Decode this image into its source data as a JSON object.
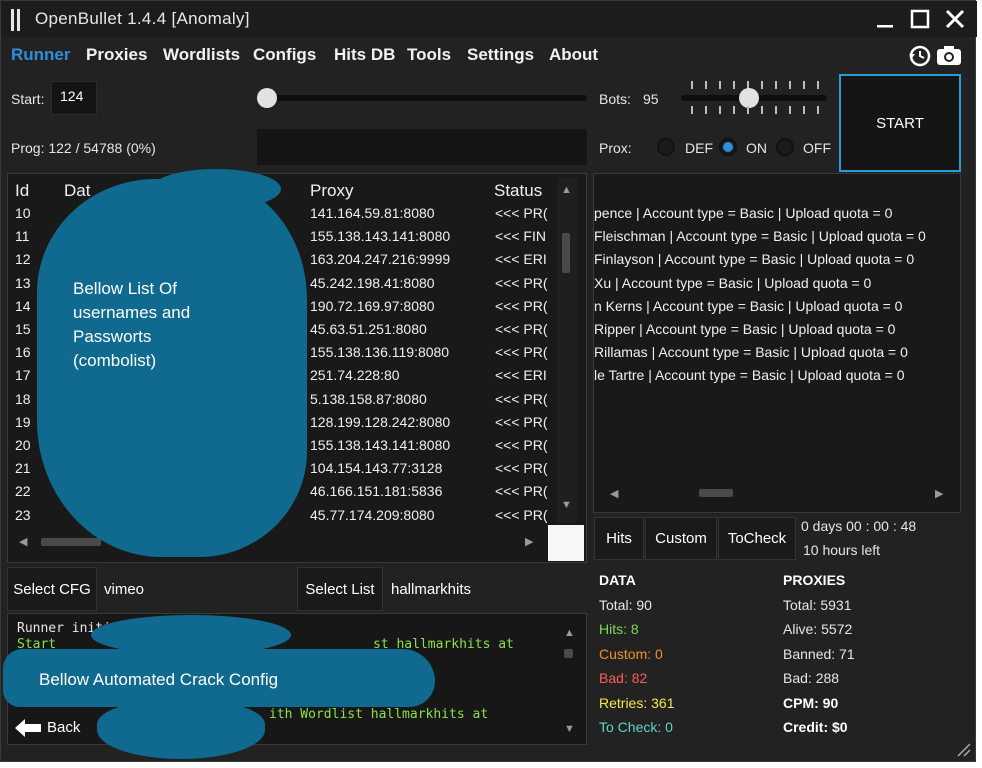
{
  "window": {
    "title": "OpenBullet 1.4.4 [Anomaly]"
  },
  "menu": [
    "Runner",
    "Proxies",
    "Wordlists",
    "Configs",
    "Hits DB",
    "Tools",
    "Settings",
    "About"
  ],
  "controls": {
    "start_label": "Start:",
    "start_value": "124",
    "bots_label": "Bots:",
    "bots_value": "95",
    "prog_text": "Prog: 122 / 54788 (0%)",
    "prox_label": "Prox:",
    "prox_options": [
      "DEF",
      "ON",
      "OFF"
    ],
    "prox_selected": "ON",
    "start_button": "START"
  },
  "table": {
    "headers": [
      "Id",
      "Dat",
      "Proxy",
      "Status"
    ],
    "rows": [
      {
        "id": "10",
        "proxy": "141.164.59.81:8080",
        "status": "<<< PR("
      },
      {
        "id": "11",
        "proxy": "155.138.143.141:8080",
        "status": "<<< FIN"
      },
      {
        "id": "12",
        "proxy": "163.204.247.216:9999",
        "status": "<<< ERI"
      },
      {
        "id": "13",
        "proxy": "45.242.198.41:8080",
        "status": "<<< PR("
      },
      {
        "id": "14",
        "proxy": "190.72.169.97:8080",
        "status": "<<< PR("
      },
      {
        "id": "15",
        "proxy": "45.63.51.251:8080",
        "status": "<<< PR("
      },
      {
        "id": "16",
        "proxy": "155.138.136.119:8080",
        "status": "<<< PR("
      },
      {
        "id": "17",
        "proxy": "251.74.228:80",
        "status": "<<< ERI"
      },
      {
        "id": "18",
        "proxy": "5.138.158.87:8080",
        "status": "<<< PR("
      },
      {
        "id": "19",
        "proxy": "128.199.128.242:8080",
        "status": "<<< PR("
      },
      {
        "id": "20",
        "proxy": "155.138.143.141:8080",
        "status": "<<< PR("
      },
      {
        "id": "21",
        "proxy": "104.154.143.77:3128",
        "status": "<<< PR("
      },
      {
        "id": "22",
        "proxy": "46.166.151.181:5836",
        "status": "<<< PR("
      },
      {
        "id": "23",
        "proxy": "45.77.174.209:8080",
        "status": "<<< PR("
      }
    ]
  },
  "hits_lines": [
    "pence | Account type = Basic | Upload quota = 0",
    "Fleischman | Account type = Basic | Upload quota = 0",
    "Finlayson | Account type = Basic | Upload quota = 0",
    "Xu | Account type = Basic | Upload quota = 0",
    "n Kerns | Account type = Basic | Upload quota = 0",
    "Ripper | Account type = Basic | Upload quota = 0",
    "Rillamas | Account type = Basic | Upload quota = 0",
    "le Tartre | Account type = Basic | Upload quota = 0"
  ],
  "tabs": [
    "Hits",
    "Custom",
    "ToCheck"
  ],
  "timer": {
    "elapsed": "0  days 00 : 00 : 48",
    "left": "10 hours left"
  },
  "select": {
    "cfg_button": "Select CFG",
    "cfg_value": "vimeo",
    "list_button": "Select List",
    "list_value": "hallmarkhits"
  },
  "console": [
    "Runner initiali",
    "Start",
    "st hallmarkhits at",
    "ith Wordlist hallmarkhits at"
  ],
  "back_label": "Back",
  "data_stats": {
    "title": "DATA",
    "total": "Total:  90",
    "hits": "Hits:  8",
    "custom": "Custom:  0",
    "bad": "Bad:  82",
    "retries": "Retries:  361",
    "tocheck": "To Check:  0"
  },
  "proxy_stats": {
    "title": "PROXIES",
    "total": "Total:  5931",
    "alive": "Alive:  5572",
    "banned": "Banned:  71",
    "bad": "Bad:  288",
    "cpm": "CPM:  90",
    "credit": "Credit:  $0"
  },
  "annotations": {
    "blob_top": [
      "Bellow List Of",
      "usernames and",
      "Passworts",
      "(combolist)"
    ],
    "blob_bottom": "Bellow Automated Crack Config"
  },
  "colors": {
    "accent": "#2d8fdc",
    "hits": "#7ed957",
    "custom": "#f0902a",
    "bad": "#ff5c5c",
    "retries": "#f6e64a",
    "tocheck": "#5fd3c6",
    "annotation": "#10698f"
  }
}
